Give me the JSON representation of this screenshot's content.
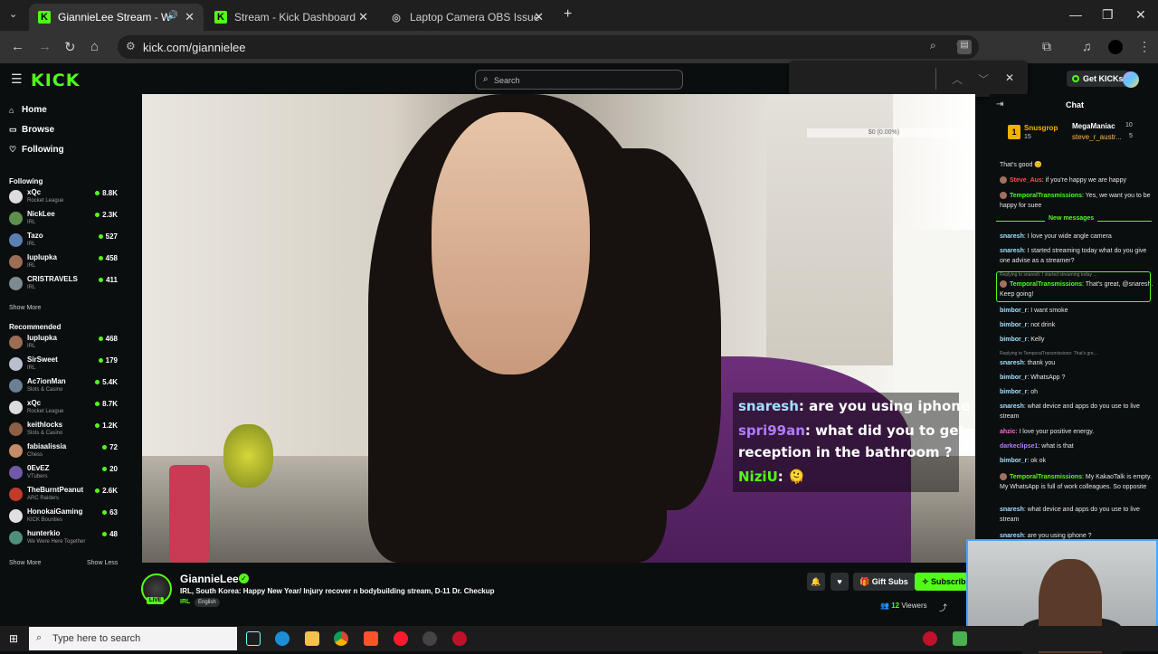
{
  "browser": {
    "tabs": [
      {
        "label": "GiannieLee Stream - Watch Live c",
        "active": true
      },
      {
        "label": "Stream - Kick Dashboard",
        "active": false
      },
      {
        "label": "Laptop Camera OBS Issue",
        "active": false
      }
    ],
    "url": "kick.com/giannielee"
  },
  "kick": {
    "logo": "KICK",
    "search_placeholder": "Search",
    "get_kicks": "Get KICKs",
    "nav": [
      {
        "label": "Home"
      },
      {
        "label": "Browse"
      },
      {
        "label": "Following"
      }
    ],
    "following_title": "Following",
    "following": [
      {
        "name": "xQc",
        "category": "Rocket League",
        "viewers": "8.8K",
        "color": "#dcdcdc"
      },
      {
        "name": "NickLee",
        "category": "IRL",
        "viewers": "2.3K",
        "color": "#5f8f4e"
      },
      {
        "name": "Tazo",
        "category": "IRL",
        "viewers": "527",
        "color": "#5a7fb3"
      },
      {
        "name": "lupIupka",
        "category": "IRL",
        "viewers": "458",
        "color": "#9c6d55"
      },
      {
        "name": "CRISTRAVELS",
        "category": "IRL",
        "viewers": "411",
        "color": "#7e8a91"
      }
    ],
    "show_more": "Show More",
    "recommended_title": "Recommended",
    "recommended": [
      {
        "name": "lupIupka",
        "category": "IRL",
        "viewers": "468",
        "color": "#9c6d55"
      },
      {
        "name": "SirSweet",
        "category": "IRL",
        "viewers": "179",
        "color": "#b9bfd0"
      },
      {
        "name": "Ac7ionMan",
        "category": "Slots & Casino",
        "viewers": "5.4K",
        "color": "#6b7f95"
      },
      {
        "name": "xQc",
        "category": "Rocket League",
        "viewers": "8.7K",
        "color": "#dcdcdc"
      },
      {
        "name": "keithlocks",
        "category": "Slots & Casino",
        "viewers": "1.2K",
        "color": "#8d5f47"
      },
      {
        "name": "fabiaalissia",
        "category": "Chess",
        "viewers": "72",
        "color": "#c58c6a"
      },
      {
        "name": "0EvEZ",
        "category": "VTubers",
        "viewers": "20",
        "color": "#6f5aa8"
      },
      {
        "name": "TheBurntPeanut",
        "category": "ARC Raiders",
        "viewers": "2.6K",
        "color": "#c23a2a"
      },
      {
        "name": "HonokaiGaming",
        "category": "KICK Bounties",
        "viewers": "63",
        "color": "#e0e0e0"
      },
      {
        "name": "hunterkio",
        "category": "We Were Here Together",
        "viewers": "48",
        "color": "#4f8f7a"
      }
    ],
    "show_less": "Show Less",
    "stream": {
      "streamer": "GiannieLee",
      "title": "IRL, South Korea: Happy New Year/ Injury recover n bodybuilding stream, D-11 Dr. Checkup",
      "category": "IRL",
      "language": "English",
      "live": "LIVE",
      "gift_subs": "Gift Subs",
      "subscribe": "Subscribe",
      "viewers": "12",
      "viewers_label": "Viewers",
      "meter": "$0 (0.00%)"
    },
    "overlay": [
      {
        "user": "snaresh",
        "text": ": are you using iphone ?"
      },
      {
        "user": "spri99an",
        "text": ": what did you to get"
      },
      {
        "user": "",
        "text": "reception in the bathroom ?"
      },
      {
        "user": "NiziU",
        "text": ": 🫠"
      }
    ],
    "chat": {
      "title": "Chat",
      "gifters": [
        {
          "name": "Snusgrop",
          "count": "15"
        },
        {
          "name": "MegaManiac",
          "count": "10"
        },
        {
          "name": "steve_r_austr...",
          "count": "5"
        }
      ],
      "new_messages": "New messages",
      "messages": [
        {
          "user": "",
          "text": "That's good 😊",
          "color": "#ffffff"
        },
        {
          "user": "Steve_Aus",
          "text": ": if you're happy we are happy",
          "color": "#ff4d4d"
        },
        {
          "user": "TemporalTransmissions",
          "text": ": Yes, we want you to be happy for suee",
          "color": "#53fc18"
        },
        {
          "user": "snaresh",
          "text": ": I love your wide angle camera",
          "color": "#9fe0ff"
        },
        {
          "user": "snaresh",
          "text": ": I started streaming today what do you give one advise as a streamer?",
          "color": "#9fe0ff"
        },
        {
          "user": "TemporalTransmissions",
          "text": ": That's great, @snaresh. Keep going!",
          "color": "#53fc18"
        },
        {
          "user": "bimbor_r",
          "text": ": I want smoke",
          "color": "#9fe0ff"
        },
        {
          "user": "bimbor_r",
          "text": ": not drink",
          "color": "#9fe0ff"
        },
        {
          "user": "bimbor_r",
          "text": ": Kelly",
          "color": "#9fe0ff"
        },
        {
          "user": "snaresh",
          "text": ": thank you",
          "color": "#9fe0ff"
        },
        {
          "user": "bimbor_r",
          "text": ": WhatsApp ?",
          "color": "#9fe0ff"
        },
        {
          "user": "bimbor_r",
          "text": ": oh",
          "color": "#9fe0ff"
        },
        {
          "user": "snaresh",
          "text": ": what device and apps do you use to live stream",
          "color": "#9fe0ff"
        },
        {
          "user": "ahzic",
          "text": ": I love your positive energy.",
          "color": "#ff6ad5"
        },
        {
          "user": "darkeclipse1",
          "text": ": what is that",
          "color": "#b07cff"
        },
        {
          "user": "bimbor_r",
          "text": ": ok ok",
          "color": "#9fe0ff"
        },
        {
          "user": "TemporalTransmissions",
          "text": ": My KakaoTalk is empty. My WhatsApp is full of work colleagues. So opposite",
          "color": "#53fc18"
        },
        {
          "user": "snaresh",
          "text": ": what device and apps do you use to live stream",
          "color": "#9fe0ff"
        },
        {
          "user": "snaresh",
          "text": ": are you using iphone ?",
          "color": "#9fe0ff"
        }
      ],
      "reply1": "Replying to snaresh: I started streaming today ...",
      "reply2": "Replying to TemporalTransmissions: That's gre..."
    }
  },
  "taskbar": {
    "search_placeholder": "Type here to search"
  }
}
